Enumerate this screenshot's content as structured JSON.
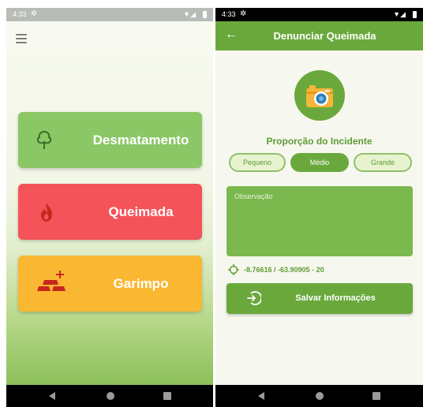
{
  "left_screen": {
    "status_bar": {
      "time": "4:33"
    },
    "categories": [
      {
        "label": "Desmatamento",
        "icon": "tree-icon",
        "color": "#8cc766"
      },
      {
        "label": "Queimada",
        "icon": "flame-icon",
        "color": "#f4535a"
      },
      {
        "label": "Garimpo",
        "icon": "gold-bars-icon",
        "color": "#fab731"
      }
    ]
  },
  "right_screen": {
    "status_bar": {
      "time": "4:33"
    },
    "app_bar": {
      "title": "Denunciar Queimada"
    },
    "section_title": "Proporção do Incidente",
    "size_options": [
      "Pequeno",
      "Médio",
      "Grande"
    ],
    "selected_size": "Médio",
    "observation": {
      "placeholder": "Observação",
      "value": ""
    },
    "location": "-8.76616 / -63.90905 - 20",
    "save_label": "Salvar Informações"
  },
  "colors": {
    "primary_green": "#6aa83c",
    "light_green": "#8cc766",
    "red": "#f4535a",
    "yellow": "#fab731"
  }
}
